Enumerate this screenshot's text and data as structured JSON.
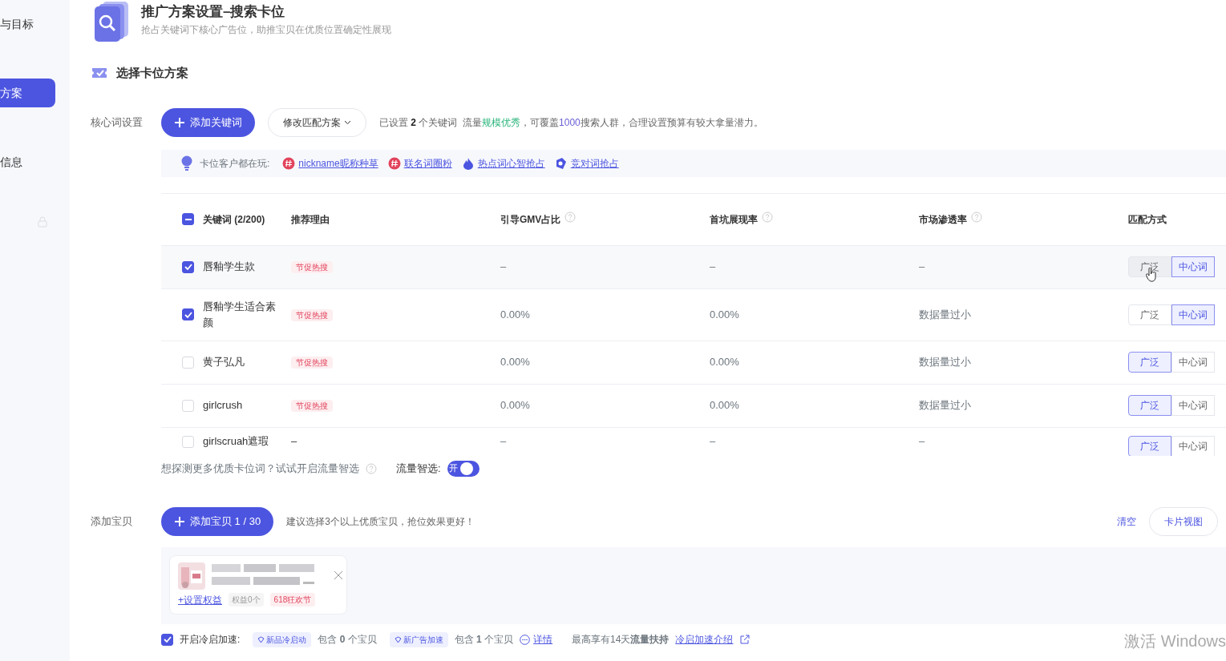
{
  "sidebar": {
    "items": [
      {
        "label": "与目标",
        "selected": false
      },
      {
        "label": "方案",
        "selected": true
      },
      {
        "label": "信息",
        "selected": false
      }
    ]
  },
  "header": {
    "title": "推广方案设置–搜索卡位",
    "subtitle": "抢占关键词下核心广告位，助推宝贝在优质位置确定性展现"
  },
  "section_title": "选择卡位方案",
  "keywords": {
    "label": "核心词设置",
    "add_button": "添加关键词",
    "match_button": "修改匹配方案",
    "summary": [
      {
        "kind": "plain",
        "text": "已设置 "
      },
      {
        "kind": "bold",
        "text": "2"
      },
      {
        "kind": "plain",
        "text": " 个关键词  流量"
      },
      {
        "kind": "good",
        "text": "规模优秀"
      },
      {
        "kind": "plain",
        "text": "，可覆盖"
      },
      {
        "kind": "accent",
        "text": "1000"
      },
      {
        "kind": "plain",
        "text": "搜索人群，合理设置预算有较大拿量潜力。"
      }
    ],
    "tips_label": "卡位客户都在玩:",
    "tips": [
      {
        "kind": "hash",
        "label": "nickname昵称种草"
      },
      {
        "kind": "hash",
        "label": "联名词圈粉"
      },
      {
        "kind": "hot",
        "label": "热点词心智抢占"
      },
      {
        "kind": "pk",
        "label": "竞对词抢占"
      }
    ]
  },
  "table": {
    "select_all": {
      "kind": "partial"
    },
    "columns": [
      {
        "label": "关键词 (2/200)",
        "help": false
      },
      {
        "label": "推荐理由",
        "help": false
      },
      {
        "label": "引导GMV占比",
        "help": true
      },
      {
        "label": "首坑展现率",
        "help": true
      },
      {
        "label": "市场渗透率",
        "help": true
      },
      {
        "label": "匹配方式",
        "help": false
      }
    ],
    "rows": [
      {
        "checked": true,
        "hovered": true,
        "keyword": "唇釉学生款",
        "reason": {
          "kind": "tag",
          "text": "节促热搜"
        },
        "gmv": "–",
        "first_rate": "–",
        "penetration": "–",
        "match": [
          {
            "label": "广泛",
            "selected": false
          },
          {
            "label": "中心词",
            "selected": true
          }
        ]
      },
      {
        "checked": true,
        "hovered": false,
        "keyword": "唇釉学生适合素颜",
        "reason": {
          "kind": "tag",
          "text": "节促热搜"
        },
        "gmv": "0.00%",
        "first_rate": "0.00%",
        "penetration": "数据量过小",
        "match": [
          {
            "label": "广泛",
            "selected": false
          },
          {
            "label": "中心词",
            "selected": true
          }
        ]
      },
      {
        "checked": false,
        "hovered": false,
        "keyword": "黄子弘凡",
        "reason": {
          "kind": "tag",
          "text": "节促热搜"
        },
        "gmv": "0.00%",
        "first_rate": "0.00%",
        "penetration": "数据量过小",
        "match": [
          {
            "label": "广泛",
            "selected": true
          },
          {
            "label": "中心词",
            "selected": false
          }
        ]
      },
      {
        "checked": false,
        "hovered": false,
        "keyword": "girlcrush",
        "reason": {
          "kind": "tag",
          "text": "节促热搜"
        },
        "gmv": "0.00%",
        "first_rate": "0.00%",
        "penetration": "数据量过小",
        "match": [
          {
            "label": "广泛",
            "selected": true
          },
          {
            "label": "中心词",
            "selected": false
          }
        ]
      },
      {
        "checked": false,
        "hovered": false,
        "keyword": "girlscruah遮瑕",
        "reason": {
          "kind": "text",
          "text": "–"
        },
        "gmv": "–",
        "first_rate": "–",
        "penetration": "–",
        "match": [
          {
            "label": "广泛",
            "selected": true
          },
          {
            "label": "中心词",
            "selected": false
          }
        ]
      }
    ]
  },
  "traffic": {
    "question": "想探测更多优质卡位词？试试开启流量智选",
    "switch_label": "流量智选:",
    "switch_on": true,
    "switch_text": "开"
  },
  "products": {
    "label": "添加宝贝",
    "add_button": "添加宝贝 1 / 30",
    "hint": "建议选择3个以上优质宝贝，抢位效果更好！",
    "clear": "清空",
    "view_button": "卡片视图",
    "items": [
      {
        "set_rights": "+设置权益",
        "rights_count": "权益0个",
        "promo": "618狂欢节"
      }
    ]
  },
  "cold_start": {
    "checked": true,
    "label": "开启冷启加速:",
    "parts": [
      {
        "kind": "tag",
        "text": "新品冷启动"
      },
      {
        "kind": "text",
        "text": "包含 **0** 个宝贝"
      },
      {
        "kind": "tag",
        "text": "新广告加速"
      },
      {
        "kind": "text",
        "text": "包含 **1** 个宝贝"
      },
      {
        "kind": "detail",
        "text": "详情"
      },
      {
        "kind": "text",
        "text": "最高享有14天**流量扶持**"
      },
      {
        "kind": "external",
        "text": "冷启加速介绍"
      }
    ]
  },
  "os_notice": "激活 Windows"
}
